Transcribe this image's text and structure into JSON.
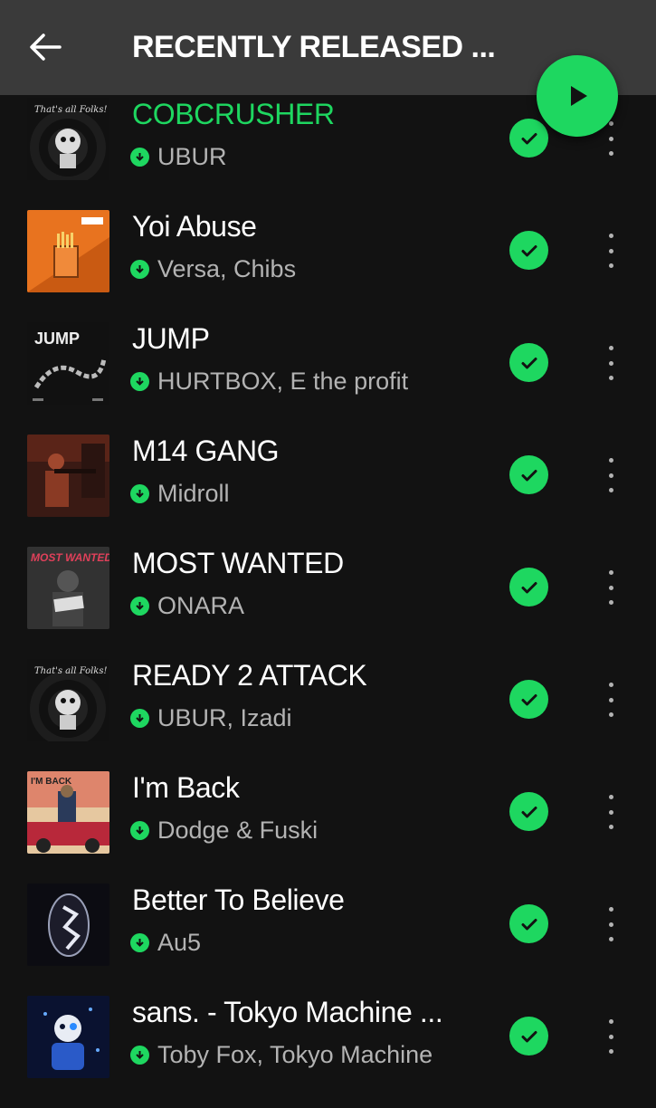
{
  "header": {
    "title": "RECENTLY RELEASED ..."
  },
  "icons": {
    "back": "arrow-left-icon",
    "play": "play-icon",
    "check": "check-circle-icon",
    "download": "downloaded-icon",
    "more": "more-vertical-icon"
  },
  "colors": {
    "accent": "#1ed760",
    "background": "#121212",
    "header": "#3a3a3a",
    "secondary_text": "#b3b3b3"
  },
  "tracks": [
    {
      "title": "COBCRUSHER",
      "artists": "UBUR",
      "playing": true,
      "downloaded": true,
      "liked": true
    },
    {
      "title": "Yoi Abuse",
      "artists": "Versa, Chibs",
      "downloaded": true,
      "liked": true
    },
    {
      "title": "JUMP",
      "artists": "HURTBOX, E the profit",
      "downloaded": true,
      "liked": true
    },
    {
      "title": "M14 GANG",
      "artists": "Midroll",
      "downloaded": true,
      "liked": true
    },
    {
      "title": "MOST WANTED",
      "artists": "ONARA",
      "downloaded": true,
      "liked": true
    },
    {
      "title": "READY 2 ATTACK",
      "artists": "UBUR, Izadi",
      "downloaded": true,
      "liked": true
    },
    {
      "title": "I'm Back",
      "artists": "Dodge & Fuski",
      "downloaded": true,
      "liked": true
    },
    {
      "title": "Better To Believe",
      "artists": "Au5",
      "downloaded": true,
      "liked": true
    },
    {
      "title": "sans. - Tokyo Machine ...",
      "artists": "Toby Fox, Tokyo Machine",
      "downloaded": true,
      "liked": true
    }
  ]
}
